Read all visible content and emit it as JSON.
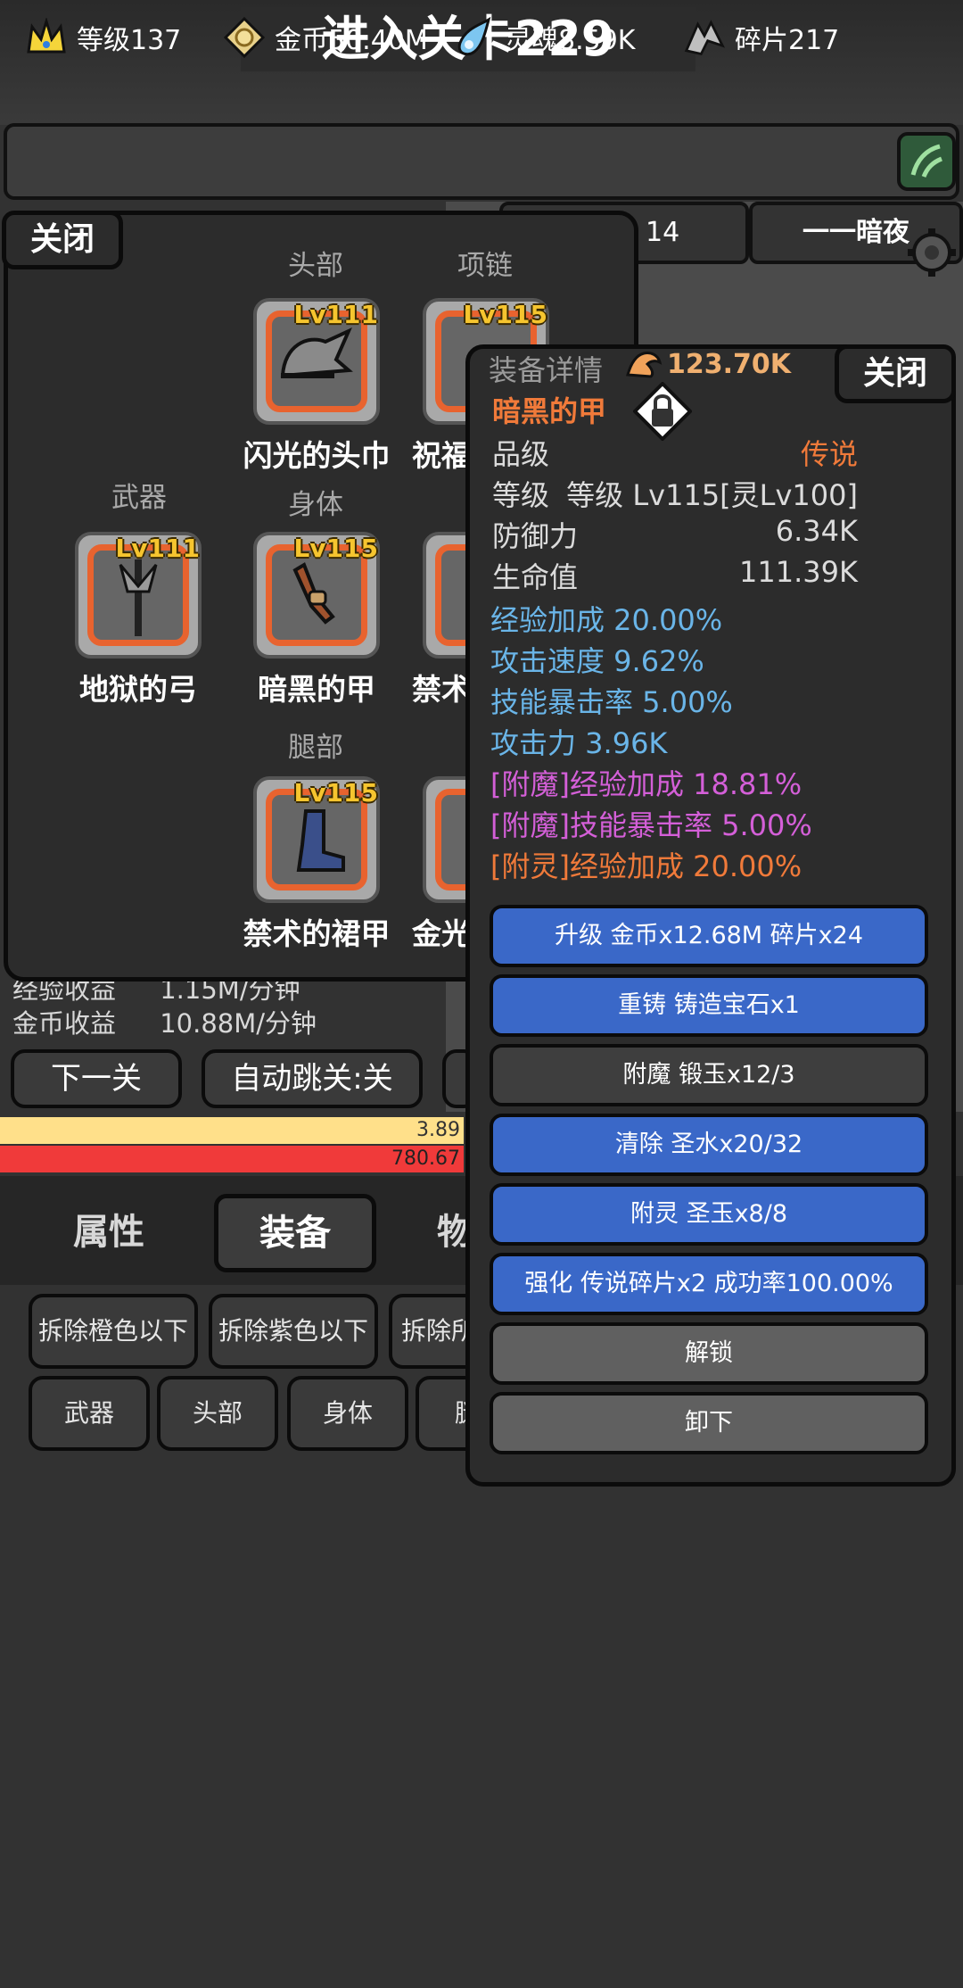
{
  "header": {
    "stage_title": "进入关卡229"
  },
  "resources": [
    {
      "icon": "crown-icon",
      "label": "等级137"
    },
    {
      "icon": "gold-coin-icon",
      "label": "金币50.40M"
    },
    {
      "icon": "soul-icon",
      "label": "灵魂8.59K"
    },
    {
      "icon": "shard-icon",
      "label": "碎片217"
    }
  ],
  "scene": {
    "tab_right_count": "14",
    "tab_dark": "一一暗夜"
  },
  "equip_panel": {
    "close_label": "关闭",
    "slots": [
      {
        "slot_label": "头部",
        "level": "Lv111",
        "name": "闪光的头巾"
      },
      {
        "slot_label": "项链",
        "level": "Lv115",
        "name": "祝福"
      },
      {
        "slot_label": "武器",
        "level": "Lv111",
        "name": "地狱的弓"
      },
      {
        "slot_label": "身体",
        "level": "Lv115",
        "name": "暗黑的甲"
      },
      {
        "slot_label": "",
        "level": "",
        "name": "禁术"
      },
      {
        "slot_label": "腿部",
        "level": "Lv115",
        "name": "禁术的裙甲"
      },
      {
        "slot_label": "",
        "level": "",
        "name": "金光"
      }
    ]
  },
  "stats": {
    "exp_income_label": "经验收益",
    "exp_income_value": "1.15M/分钟",
    "gold_income_label": "金币收益",
    "gold_income_value": "10.88M/分钟",
    "next_stage": "下一关",
    "auto_skip": "自动跳关:关",
    "bar_yellow_value": "3.89",
    "bar_red_value": "780.67"
  },
  "bottom_tabs": {
    "attributes": "属性",
    "equipment": "装备",
    "items": "物"
  },
  "filters": {
    "row1": [
      "拆除橙色以下",
      "拆除紫色以下",
      "拆除所"
    ],
    "row2": [
      "武器",
      "头部",
      "身体",
      "腿"
    ]
  },
  "detail": {
    "title": "装备详情",
    "power": "123.70K",
    "close_label": "关闭",
    "item_name": "暗黑的甲",
    "quality_label": "品级",
    "quality_value": "传说",
    "level_label": "等级",
    "level_value": "等级 Lv115[灵Lv100]",
    "defense_label": "防御力",
    "defense_value": "6.34K",
    "hp_label": "生命值",
    "hp_value": "111.39K",
    "bonus_lines": [
      "经验加成 20.00%",
      "攻击速度 9.62%",
      "技能暴击率 5.00%",
      "攻击力 3.96K"
    ],
    "enchant_lines": [
      "[附魔]经验加成 18.81%",
      "[附魔]技能暴击率 5.00%"
    ],
    "spirit_line": "[附灵]经验加成 20.00%",
    "actions": [
      {
        "label": "升级 金币x12.68M 碎片x24",
        "style": "blue"
      },
      {
        "label": "重铸 铸造宝石x1",
        "style": "blue"
      },
      {
        "label": "附魔 锻玉x12/3",
        "style": "dark"
      },
      {
        "label": "清除 圣水x20/32",
        "style": "blue"
      },
      {
        "label": "附灵 圣玉x8/8",
        "style": "blue"
      },
      {
        "label": "强化 传说碎片x2 成功率100.00%",
        "style": "blue"
      },
      {
        "label": "解锁",
        "style": "gray"
      },
      {
        "label": "卸下",
        "style": "gray"
      }
    ]
  },
  "colors": {
    "accent_blue": "#3a68c8",
    "slot_border": "#e8632f",
    "level_yellow": "#f6c52f",
    "legendary_orange": "#f07a3a",
    "stat_blue": "#6ab5e8",
    "enchant_purple": "#d45fd8"
  }
}
